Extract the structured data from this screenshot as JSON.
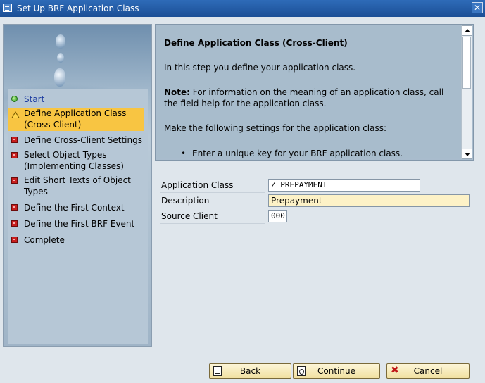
{
  "window": {
    "title": "Set Up BRF Application Class",
    "close_glyph": "✕"
  },
  "steps": [
    {
      "label": "Start",
      "status": "done",
      "icon": "green-circle-icon",
      "is_link": true
    },
    {
      "label": "Define Application Class (Cross-Client)",
      "status": "current",
      "icon": "warning-icon"
    },
    {
      "label": "Define Cross-Client Settings",
      "status": "pending",
      "icon": "red-square-icon"
    },
    {
      "label": "Select Object Types (Implementing Classes)",
      "status": "pending",
      "icon": "red-square-icon"
    },
    {
      "label": "Edit Short Texts of Object Types",
      "status": "pending",
      "icon": "red-square-icon"
    },
    {
      "label": "Define the First Context",
      "status": "pending",
      "icon": "red-square-icon"
    },
    {
      "label": "Define the First BRF Event",
      "status": "pending",
      "icon": "red-square-icon"
    },
    {
      "label": "Complete",
      "status": "pending",
      "icon": "red-square-icon"
    }
  ],
  "info": {
    "title": "Define Application Class (Cross-Client)",
    "intro": "In this step you define your application class.",
    "note_label": "Note:",
    "note_text": " For information on the meaning of an application class, call the field help for the application class.",
    "settings_text": "Make the following settings for the application class:",
    "bullet": "Enter a unique key for your BRF application class."
  },
  "form": {
    "application_class_label": "Application Class",
    "application_class_value": "Z_PREPAYMENT",
    "description_label": "Description",
    "description_value": "Prepayment",
    "source_client_label": "Source Client",
    "source_client_value": "000"
  },
  "buttons": {
    "back": "Back",
    "continue": "Continue",
    "cancel": "Cancel",
    "cancel_glyph": "✖"
  },
  "colors": {
    "title_bar": "#1b4f96",
    "active_step": "#f8c542",
    "required_field": "#fdf2c7"
  }
}
